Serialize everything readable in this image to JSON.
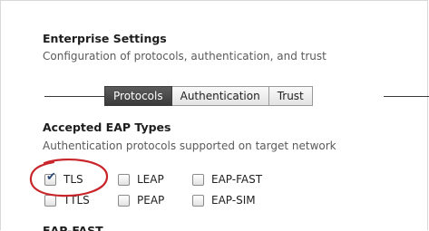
{
  "header": {
    "title": "Enterprise Settings",
    "subtitle": "Configuration of protocols, authentication, and trust"
  },
  "tabs": [
    {
      "label": "Protocols",
      "active": true
    },
    {
      "label": "Authentication",
      "active": false
    },
    {
      "label": "Trust",
      "active": false
    }
  ],
  "eap": {
    "title": "Accepted EAP Types",
    "subtitle": "Authentication protocols supported on target network",
    "options": [
      {
        "label": "TLS",
        "checked": true
      },
      {
        "label": "LEAP",
        "checked": false
      },
      {
        "label": "EAP-FAST",
        "checked": false
      },
      {
        "label": "TTLS",
        "checked": false
      },
      {
        "label": "PEAP",
        "checked": false
      },
      {
        "label": "EAP-SIM",
        "checked": false
      }
    ]
  },
  "next_section": {
    "title": "EAP-FAST"
  },
  "colors": {
    "highlight": "#c8262b",
    "active_tab": "#474747",
    "check": "#2a4a7a"
  }
}
